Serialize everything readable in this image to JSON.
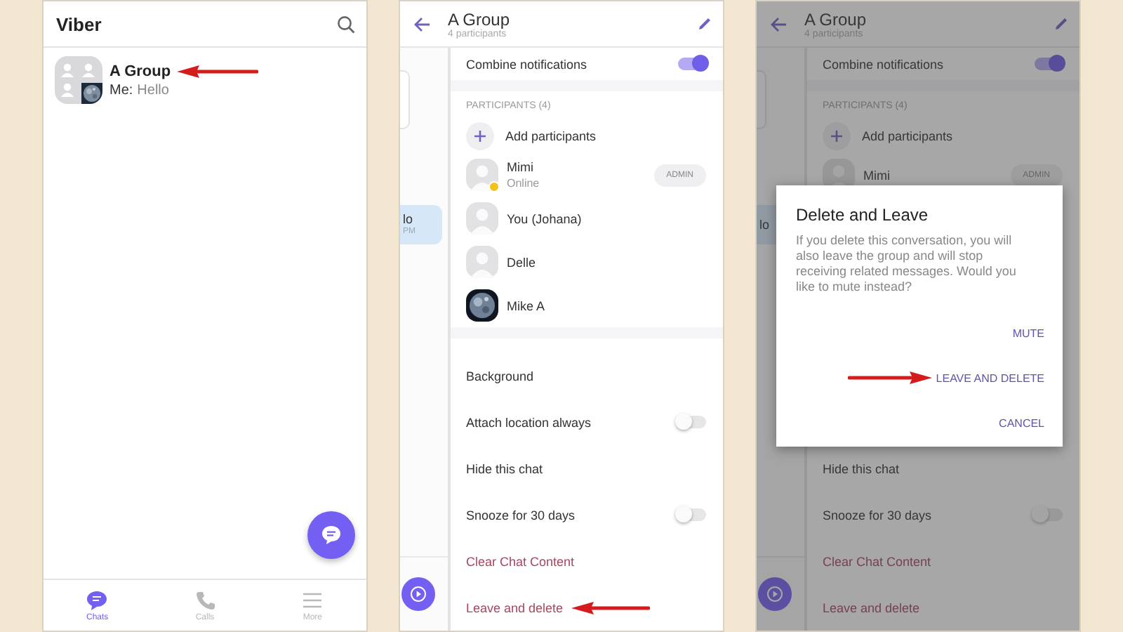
{
  "panels": [
    {
      "kind": "chat_list",
      "title": "Viber",
      "chats": [
        {
          "name": "A Group",
          "sender": "Me:",
          "preview": "Hello",
          "arrow": true
        }
      ],
      "nav": [
        {
          "label": "Chats",
          "selected": true
        },
        {
          "label": "Calls",
          "selected": false
        },
        {
          "label": "More",
          "selected": false
        }
      ]
    },
    {
      "kind": "chat_info",
      "dimmed": false,
      "title": "A Group",
      "subtitle": "4 participants",
      "bubble": {
        "text": "lo",
        "time": "PM"
      },
      "items": [
        {
          "kind": "toggle",
          "label": "Combine notifications",
          "on": true
        },
        {
          "kind": "divider"
        },
        {
          "kind": "section",
          "label": "PARTICIPANTS (4)"
        },
        {
          "kind": "add",
          "label": "Add participants"
        },
        {
          "kind": "participant",
          "name": "Mimi",
          "status": "Online",
          "online": true,
          "badge": "ADMIN",
          "has_photo": false
        },
        {
          "kind": "participant",
          "name": "You (Johana)",
          "online": false,
          "has_photo": false
        },
        {
          "kind": "participant",
          "name": "Delle",
          "online": false,
          "has_photo": false
        },
        {
          "kind": "participant",
          "name": "Mike A",
          "online": false,
          "has_photo": true
        },
        {
          "kind": "divider"
        }
      ],
      "bottom_items": [
        {
          "kind": "option",
          "label": "Background"
        },
        {
          "kind": "toggle",
          "label": "Attach location always",
          "on": false
        },
        {
          "kind": "option",
          "label": "Hide this chat"
        },
        {
          "kind": "toggle",
          "label": "Snooze for 30 days",
          "on": false
        },
        {
          "kind": "danger",
          "label": "Clear Chat Content"
        },
        {
          "kind": "danger",
          "label": "Leave and delete",
          "arrow": true
        }
      ]
    },
    {
      "kind": "chat_info",
      "dimmed": true,
      "title": "A Group",
      "subtitle": "4 participants",
      "bubble": {
        "text": "lo"
      },
      "items": [
        {
          "kind": "toggle",
          "label": "Combine notifications",
          "on": true
        },
        {
          "kind": "divider"
        },
        {
          "kind": "section",
          "label": "PARTICIPANTS (4)"
        },
        {
          "kind": "add",
          "label": "Add participants"
        },
        {
          "kind": "participant",
          "name": "Mimi",
          "badge": "ADMIN",
          "has_photo": false
        }
      ],
      "bottom_items": [
        {
          "kind": "option",
          "label": "Hide this chat"
        },
        {
          "kind": "toggle",
          "label": "Snooze for 30 days",
          "on": false
        },
        {
          "kind": "danger",
          "label": "Clear Chat Content"
        },
        {
          "kind": "danger",
          "label": "Leave and delete"
        }
      ],
      "dialog": {
        "title": "Delete and Leave",
        "message": "If you delete this conversation, you will also leave the group and will stop receiving related messages. Would you like to mute instead?",
        "actions": [
          {
            "label": "MUTE"
          },
          {
            "label": "LEAVE AND DELETE",
            "arrow": true
          },
          {
            "label": "CANCEL"
          }
        ]
      }
    }
  ]
}
